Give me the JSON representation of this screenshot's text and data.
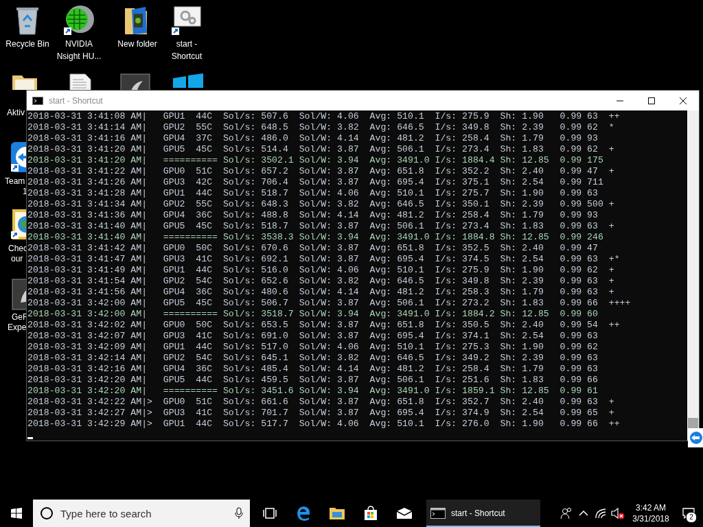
{
  "desktop": {
    "icons": [
      {
        "kind": "recycle",
        "lines": [
          "Recycle Bin"
        ]
      },
      {
        "kind": "sphere",
        "lines": [
          "NVIDIA",
          "Nsight HU..."
        ]
      },
      {
        "kind": "nvfolder",
        "lines": [
          "New folder"
        ]
      },
      {
        "kind": "gears",
        "lines": [
          "start -",
          "Shortcut"
        ]
      }
    ],
    "partial_icons": [
      {
        "kind": "document"
      },
      {
        "kind": "darkapp"
      },
      {
        "kind": "windows"
      }
    ],
    "side_icons": [
      {
        "kind": "folder",
        "lines": [
          "Aktiv"
        ]
      },
      {
        "kind": "teamviewer",
        "lines": [
          "Team",
          "1"
        ]
      },
      {
        "kind": "globe",
        "lines": [
          "Chec",
          "our"
        ]
      },
      {
        "kind": "darkapp",
        "lines": [
          "GeF",
          "Expe"
        ]
      }
    ]
  },
  "console": {
    "title": "start - Shortcut",
    "lines": [
      {
        "kind": "gpu",
        "time": "2018-03-31 3:41:08 AM|",
        "text": "   GPU1  44C  Sol/s: 507.6  Sol/W: 4.06  Avg: 510.1  I/s: 275.9  Sh: 1.90   0.99 63  ++"
      },
      {
        "kind": "gpu",
        "time": "2018-03-31 3:41:14 AM|",
        "text": "   GPU2  55C  Sol/s: 648.5  Sol/W: 3.82  Avg: 646.5  I/s: 349.8  Sh: 2.39   0.99 62  *"
      },
      {
        "kind": "gpu",
        "time": "2018-03-31 3:41:16 AM|",
        "text": "   GPU4  37C  Sol/s: 486.0  Sol/W: 4.14  Avg: 481.2  I/s: 258.4  Sh: 1.79   0.99 93"
      },
      {
        "kind": "gpu",
        "time": "2018-03-31 3:41:20 AM|",
        "text": "   GPU5  45C  Sol/s: 514.4  Sol/W: 3.87  Avg: 506.1  I/s: 273.4  Sh: 1.83   0.99 62  +"
      },
      {
        "kind": "total",
        "time": "2018-03-31 3:41:20 AM|",
        "text": "   ========== Sol/s: 3502.1 Sol/W: 3.94  Avg: 3491.0 I/s: 1884.4 Sh: 12.85  0.99 175"
      },
      {
        "kind": "gpu",
        "time": "2018-03-31 3:41:22 AM|",
        "text": "   GPU0  51C  Sol/s: 657.2  Sol/W: 3.87  Avg: 651.8  I/s: 352.2  Sh: 2.40   0.99 47  +"
      },
      {
        "kind": "gpu",
        "time": "2018-03-31 3:41:26 AM|",
        "text": "   GPU3  42C  Sol/s: 706.4  Sol/W: 3.87  Avg: 695.4  I/s: 375.1  Sh: 2.54   0.99 711"
      },
      {
        "kind": "gpu",
        "time": "2018-03-31 3:41:28 AM|",
        "text": "   GPU1  44C  Sol/s: 518.7  Sol/W: 4.06  Avg: 510.1  I/s: 275.7  Sh: 1.90   0.99 63"
      },
      {
        "kind": "gpu",
        "time": "2018-03-31 3:41:34 AM|",
        "text": "   GPU2  55C  Sol/s: 648.3  Sol/W: 3.82  Avg: 646.5  I/s: 350.1  Sh: 2.39   0.99 500 +"
      },
      {
        "kind": "gpu",
        "time": "2018-03-31 3:41:36 AM|",
        "text": "   GPU4  36C  Sol/s: 488.8  Sol/W: 4.14  Avg: 481.2  I/s: 258.4  Sh: 1.79   0.99 93"
      },
      {
        "kind": "gpu",
        "time": "2018-03-31 3:41:40 AM|",
        "text": "   GPU5  45C  Sol/s: 518.7  Sol/W: 3.87  Avg: 506.1  I/s: 273.4  Sh: 1.83   0.99 63  +"
      },
      {
        "kind": "total",
        "time": "2018-03-31 3:41:40 AM|",
        "text": "   ========== Sol/s: 3538.3 Sol/W: 3.94  Avg: 3491.0 I/s: 1884.8 Sh: 12.85  0.99 246"
      },
      {
        "kind": "gpu",
        "time": "2018-03-31 3:41:42 AM|",
        "text": "   GPU0  50C  Sol/s: 670.6  Sol/W: 3.87  Avg: 651.8  I/s: 352.5  Sh: 2.40   0.99 47"
      },
      {
        "kind": "gpu",
        "time": "2018-03-31 3:41:47 AM|",
        "text": "   GPU3  41C  Sol/s: 692.1  Sol/W: 3.87  Avg: 695.4  I/s: 374.5  Sh: 2.54   0.99 63  +*"
      },
      {
        "kind": "gpu",
        "time": "2018-03-31 3:41:49 AM|",
        "text": "   GPU1  44C  Sol/s: 516.0  Sol/W: 4.06  Avg: 510.1  I/s: 275.9  Sh: 1.90   0.99 62  +"
      },
      {
        "kind": "gpu",
        "time": "2018-03-31 3:41:54 AM|",
        "text": "   GPU2  54C  Sol/s: 652.6  Sol/W: 3.82  Avg: 646.5  I/s: 349.8  Sh: 2.39   0.99 63  +"
      },
      {
        "kind": "gpu",
        "time": "2018-03-31 3:41:56 AM|",
        "text": "   GPU4  36C  Sol/s: 480.6  Sol/W: 4.14  Avg: 481.2  I/s: 258.3  Sh: 1.79   0.99 63  +"
      },
      {
        "kind": "gpu",
        "time": "2018-03-31 3:42:00 AM|",
        "text": "   GPU5  45C  Sol/s: 506.7  Sol/W: 3.87  Avg: 506.1  I/s: 273.2  Sh: 1.83   0.99 66  ++++"
      },
      {
        "kind": "total",
        "time": "2018-03-31 3:42:00 AM|",
        "text": "   ========== Sol/s: 3518.7 Sol/W: 3.94  Avg: 3491.0 I/s: 1884.2 Sh: 12.85  0.99 60"
      },
      {
        "kind": "gpu",
        "time": "2018-03-31 3:42:02 AM|",
        "text": "   GPU0  50C  Sol/s: 653.5  Sol/W: 3.87  Avg: 651.8  I/s: 350.5  Sh: 2.40   0.99 54  ++"
      },
      {
        "kind": "gpu",
        "time": "2018-03-31 3:42:07 AM|",
        "text": "   GPU3  41C  Sol/s: 691.0  Sol/W: 3.87  Avg: 695.4  I/s: 374.1  Sh: 2.54   0.99 63"
      },
      {
        "kind": "gpu",
        "time": "2018-03-31 3:42:09 AM|",
        "text": "   GPU1  44C  Sol/s: 517.0  Sol/W: 4.06  Avg: 510.1  I/s: 275.3  Sh: 1.90   0.99 62"
      },
      {
        "kind": "gpu",
        "time": "2018-03-31 3:42:14 AM|",
        "text": "   GPU2  54C  Sol/s: 645.1  Sol/W: 3.82  Avg: 646.5  I/s: 349.2  Sh: 2.39   0.99 63"
      },
      {
        "kind": "gpu",
        "time": "2018-03-31 3:42:16 AM|",
        "text": "   GPU4  36C  Sol/s: 485.4  Sol/W: 4.14  Avg: 481.2  I/s: 258.4  Sh: 1.79   0.99 63"
      },
      {
        "kind": "gpu",
        "time": "2018-03-31 3:42:20 AM|",
        "text": "   GPU5  44C  Sol/s: 459.5  Sol/W: 3.87  Avg: 506.1  I/s: 251.6  Sh: 1.83   0.99 66"
      },
      {
        "kind": "total",
        "time": "2018-03-31 3:42:20 AM|",
        "text": "   ========== Sol/s: 3451.6 Sol/W: 3.94  Avg: 3491.0 I/s: 1859.1 Sh: 12.85  0.99 61"
      },
      {
        "kind": "gpu",
        "time": "2018-03-31 3:42:22 AM|",
        "text": ">  GPU0  51C  Sol/s: 661.6  Sol/W: 3.87  Avg: 651.8  I/s: 352.7  Sh: 2.40   0.99 63  +"
      },
      {
        "kind": "gpu",
        "time": "2018-03-31 3:42:27 AM|",
        "text": ">  GPU3  41C  Sol/s: 701.7  Sol/W: 3.87  Avg: 695.4  I/s: 374.9  Sh: 2.54   0.99 65  +"
      },
      {
        "kind": "gpu",
        "time": "2018-03-31 3:42:29 AM|",
        "text": ">  GPU1  44C  Sol/s: 517.7  Sol/W: 4.06  Avg: 510.1  I/s: 276.0  Sh: 1.90   0.99 66  ++"
      }
    ]
  },
  "taskbar": {
    "search": {
      "placeholder": "Type here to search"
    },
    "pinned": [
      {
        "kind": "taskview"
      },
      {
        "kind": "edge"
      },
      {
        "kind": "explorer"
      },
      {
        "kind": "store"
      },
      {
        "kind": "mail"
      }
    ],
    "active_app": {
      "label": "start - Shortcut",
      "selected": true
    },
    "tray": [
      {
        "kind": "people"
      },
      {
        "kind": "chevron"
      },
      {
        "kind": "network"
      },
      {
        "kind": "volume",
        "muted": true
      }
    ],
    "clock": {
      "time": "3:42 AM",
      "date": "3/31/2018"
    },
    "notifications": {
      "count": "2"
    }
  }
}
